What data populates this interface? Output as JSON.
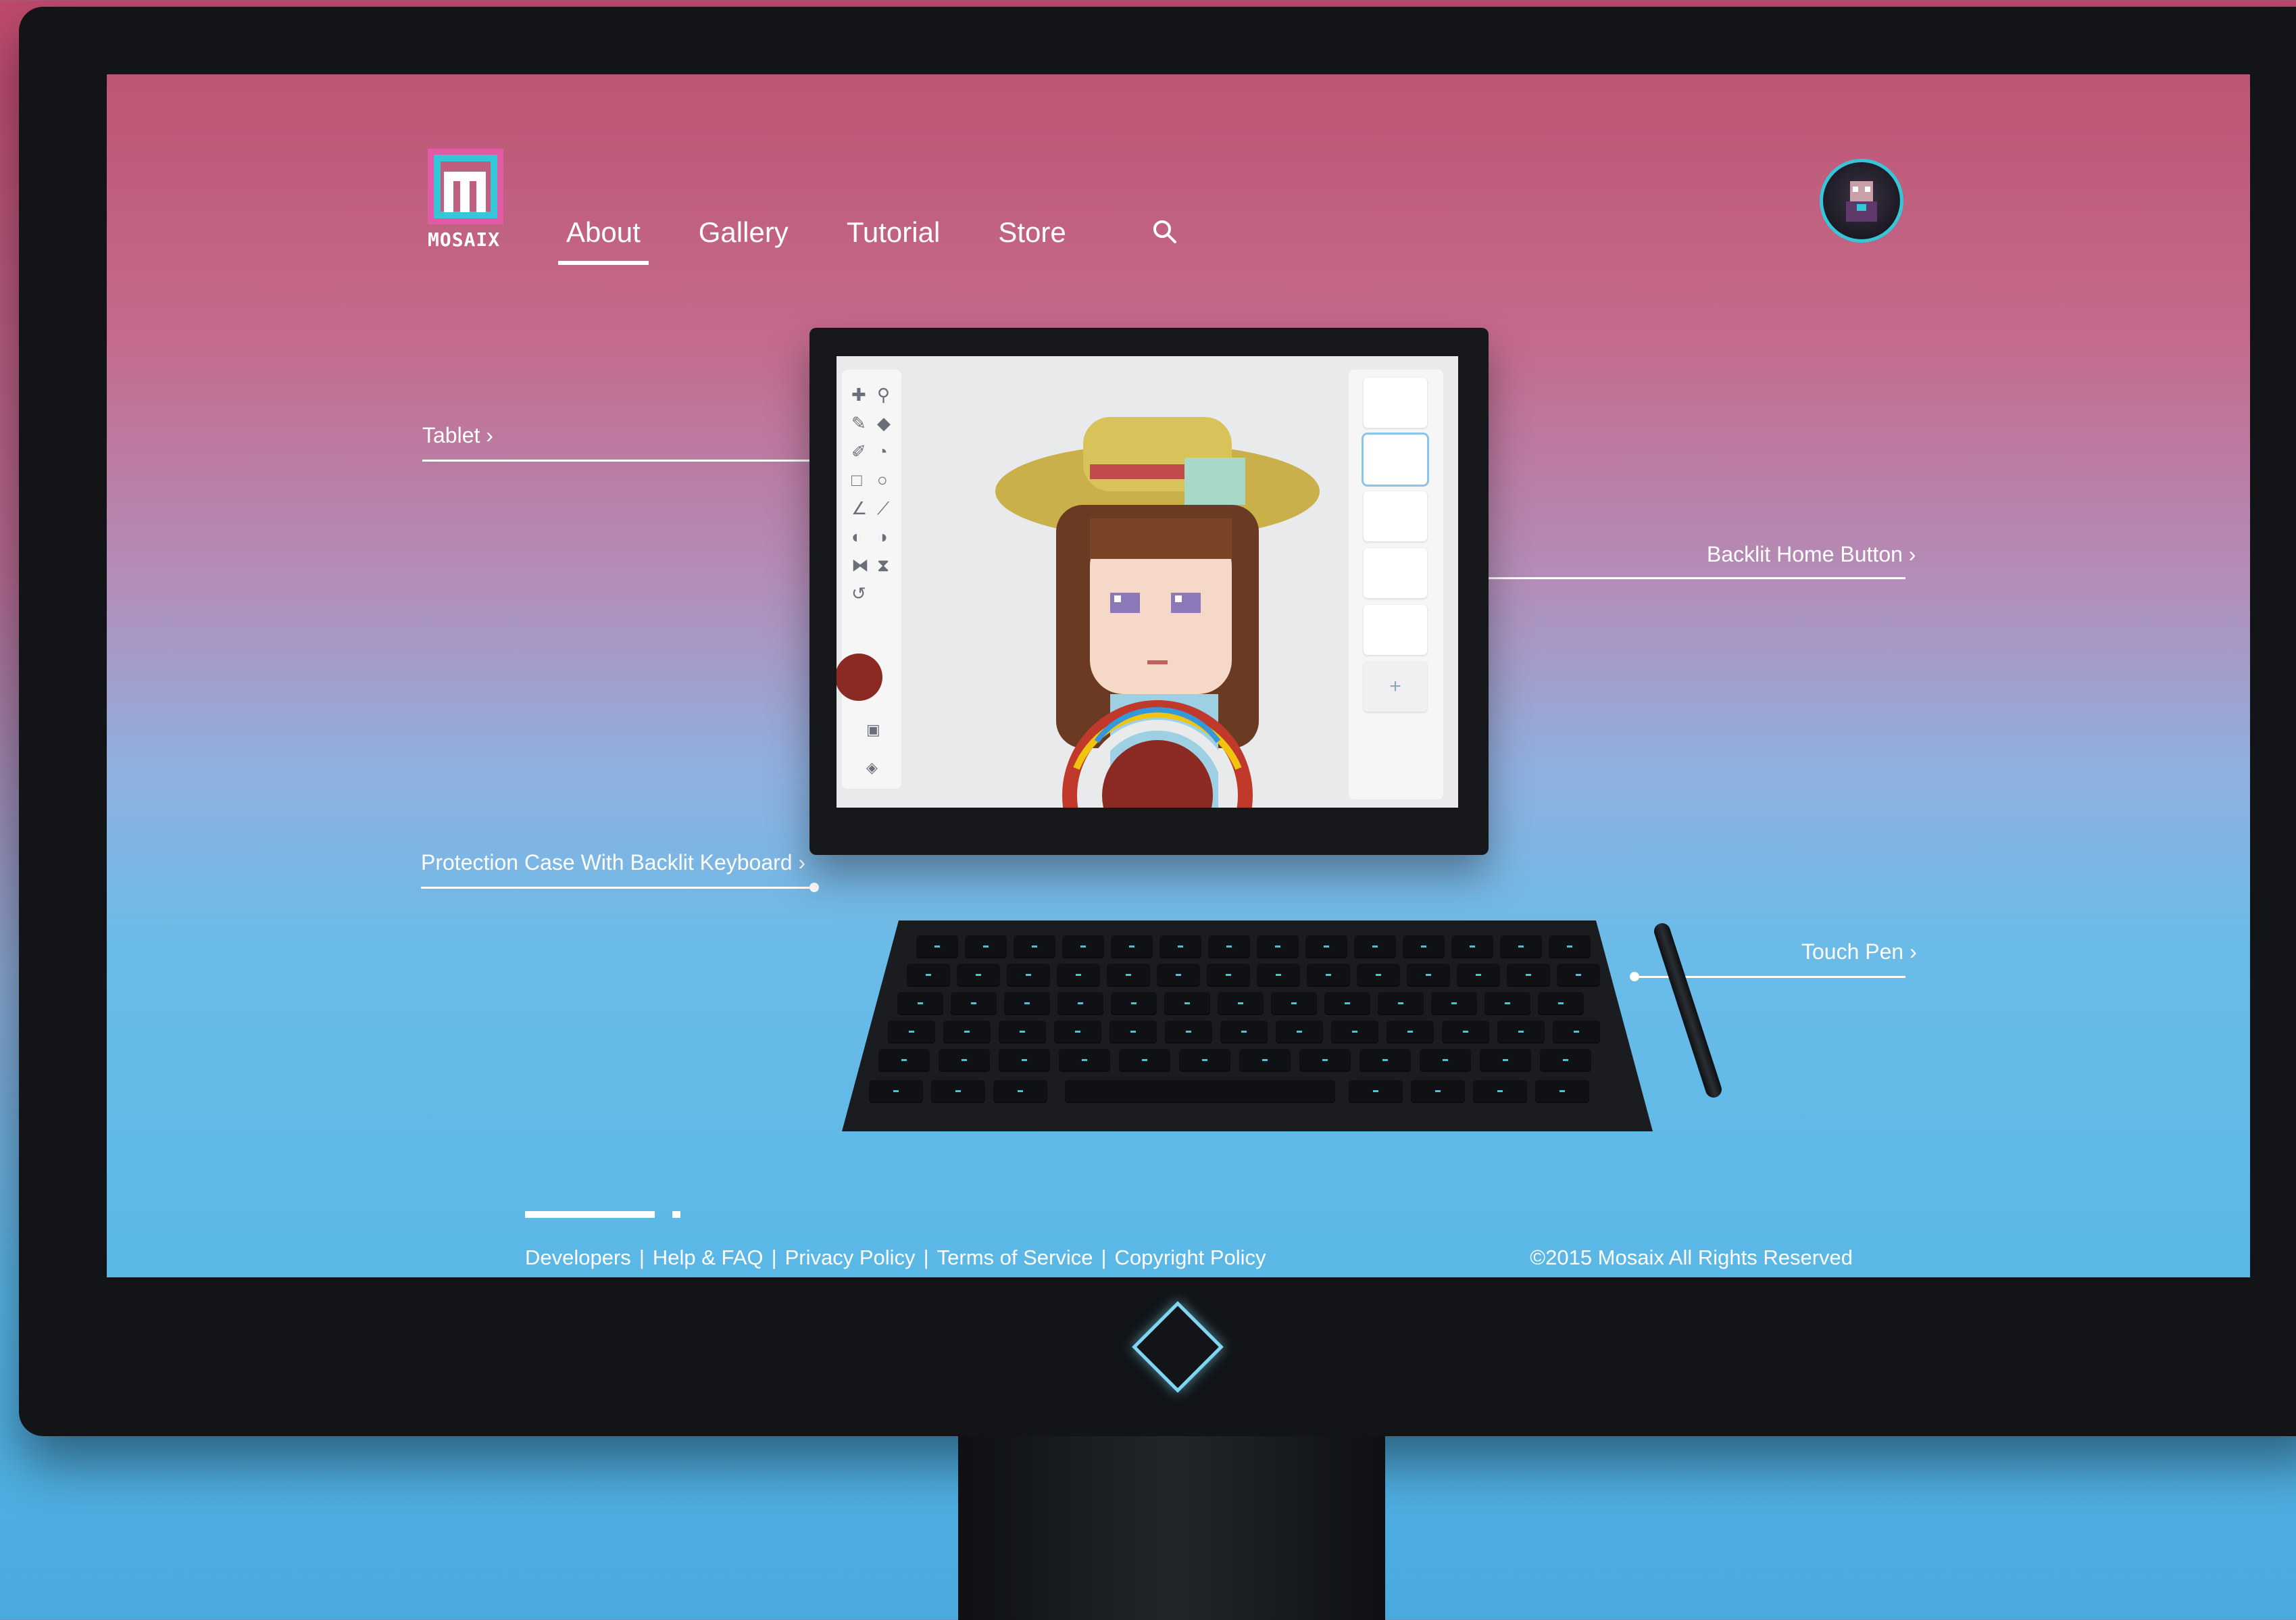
{
  "brand": {
    "logo_text": "MOSAIX"
  },
  "nav": {
    "items": [
      {
        "label": "About",
        "active": true
      },
      {
        "label": "Gallery",
        "active": false
      },
      {
        "label": "Tutorial",
        "active": false
      },
      {
        "label": "Store",
        "active": false
      }
    ],
    "search_icon": "search-icon"
  },
  "callouts": {
    "tablet": "Tablet ›",
    "home_button": "Backlit Home Button ›",
    "keyboard": "Protection Case With Backlit Keyboard ›",
    "pen": "Touch Pen ›"
  },
  "footer": {
    "links": [
      "Developers",
      "Help & FAQ",
      "Privacy Policy",
      "Terms of Service",
      "Copyright Policy"
    ],
    "separator": "|",
    "copyright": "©2015 Mosaix All Rights Reserved"
  },
  "colors": {
    "accent_cyan": "#35c6d8",
    "accent_pink": "#e05aa6",
    "key_glow": "#2fd3d6"
  }
}
